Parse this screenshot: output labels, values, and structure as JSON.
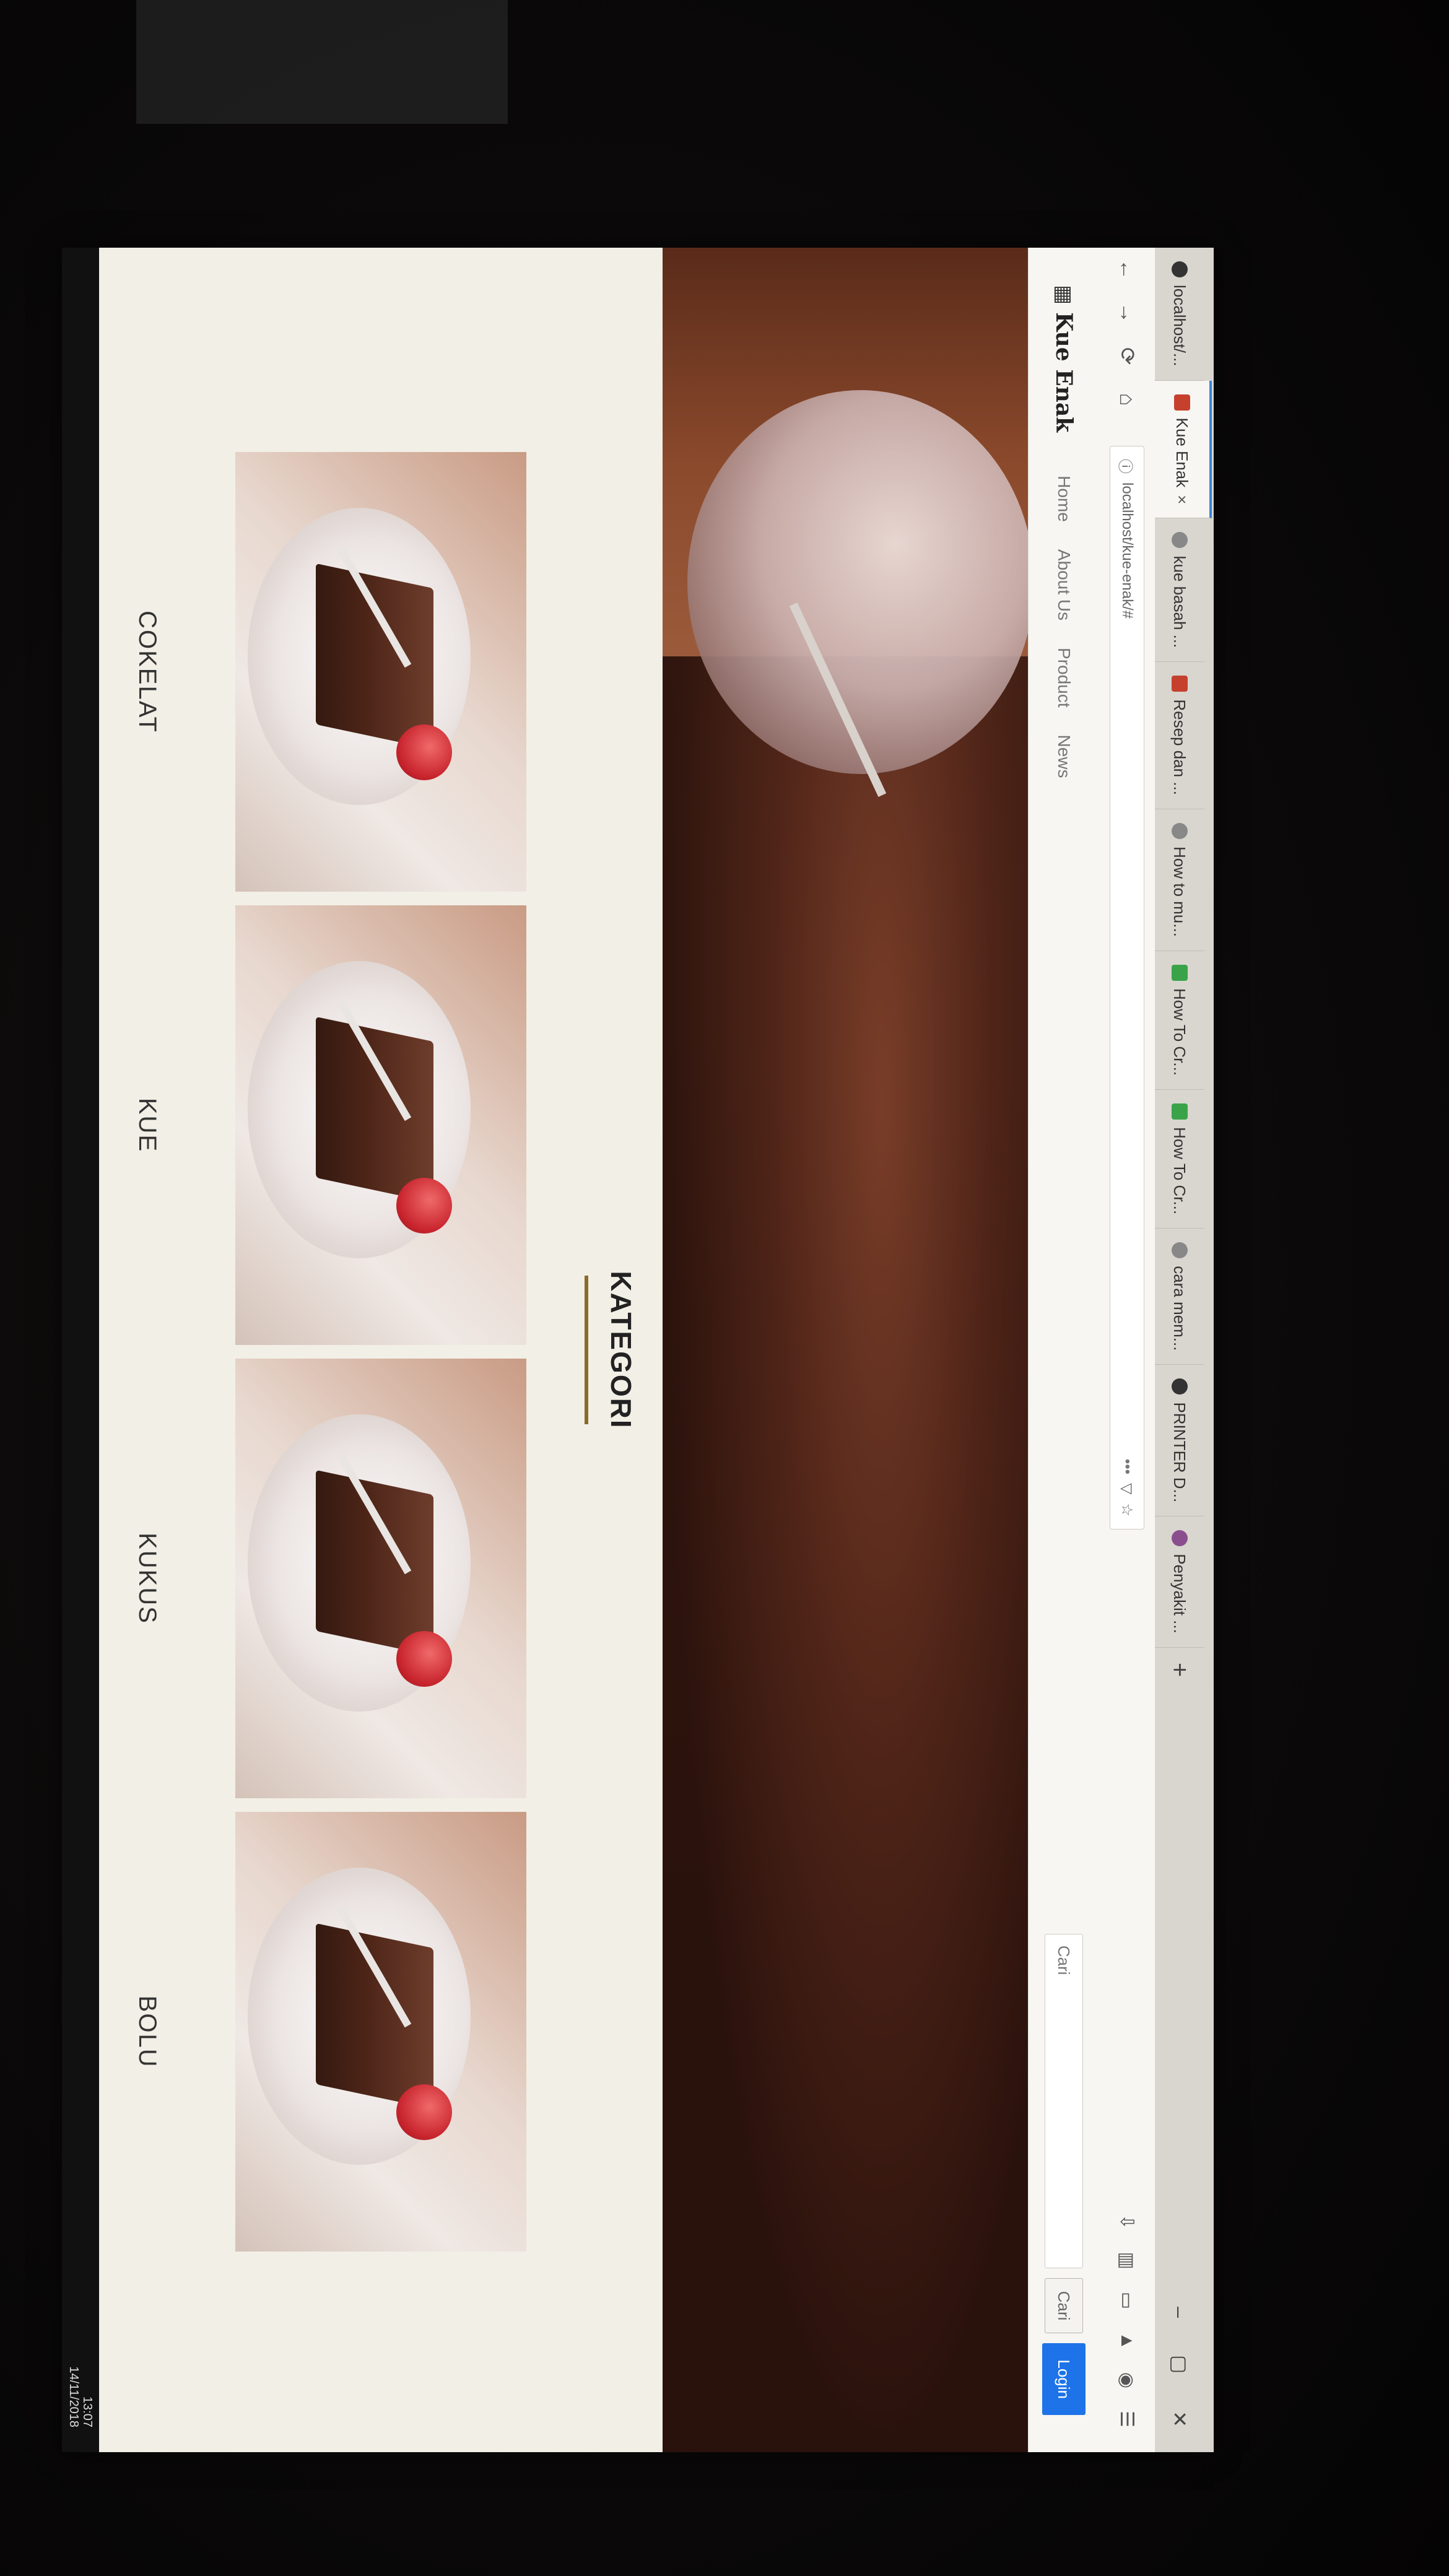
{
  "browser": {
    "tabs": [
      {
        "label": "localhost/...",
        "icon": "localhost-icon",
        "active": false
      },
      {
        "label": "Kue Enak",
        "icon": "site-favicon",
        "active": true,
        "close": "×"
      },
      {
        "label": "kue basah ...",
        "icon": "globe-icon",
        "active": false
      },
      {
        "label": "Resep dan ...",
        "icon": "recipe-icon",
        "active": false
      },
      {
        "label": "How to mu...",
        "icon": "globe-icon",
        "active": false
      },
      {
        "label": "How To Cr...",
        "icon": "green-icon",
        "active": false
      },
      {
        "label": "How To Cr...",
        "icon": "green-icon",
        "active": false
      },
      {
        "label": "cara mem...",
        "icon": "globe-icon",
        "active": false
      },
      {
        "label": "PRINTER D...",
        "icon": "printer-icon",
        "active": false
      },
      {
        "label": "Penyakit ...",
        "icon": "purple-icon",
        "active": false
      }
    ],
    "new_tab": "+",
    "window_controls": [
      "–",
      "▢",
      "✕"
    ],
    "url": "localhost/kue-enak/#",
    "url_menu": "•••"
  },
  "site": {
    "logo": "Kue Enak",
    "menu": [
      "Home",
      "About Us",
      "Product",
      "News"
    ],
    "search_placeholder": "Cari",
    "search_button": "Cari",
    "login_button": "Login"
  },
  "kategori": {
    "title": "KATEGORI",
    "items": [
      {
        "label": "COKELAT"
      },
      {
        "label": "KUE"
      },
      {
        "label": "KUKUS"
      },
      {
        "label": "BOLU"
      }
    ]
  },
  "taskbar": {
    "time": "13:07",
    "date": "14/11/2018"
  }
}
